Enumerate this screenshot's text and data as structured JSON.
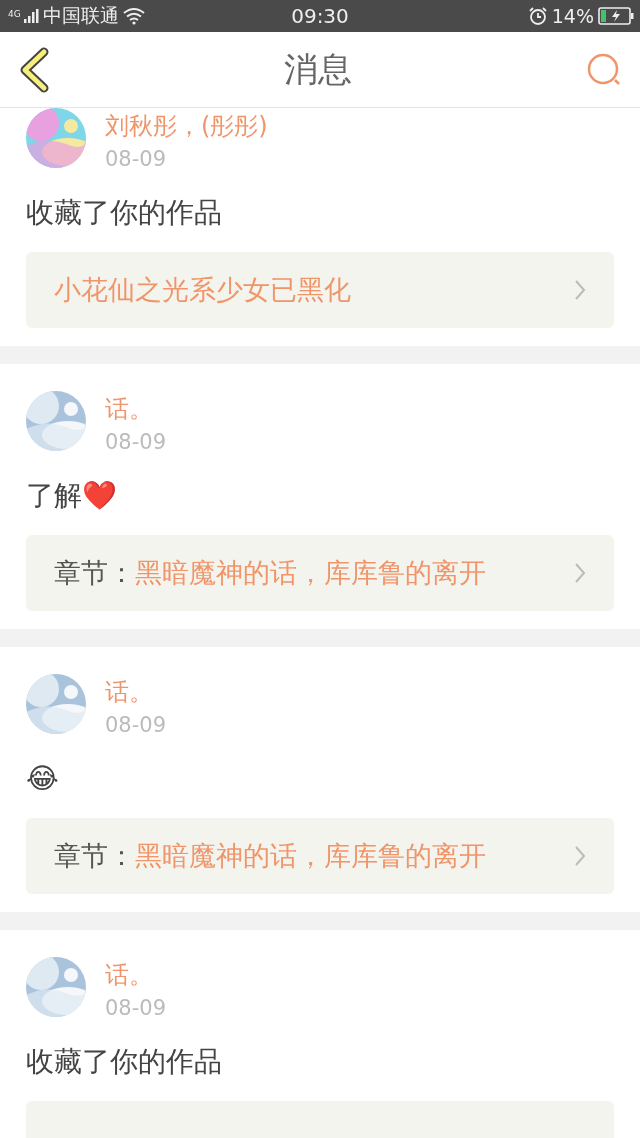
{
  "status_bar": {
    "network": "4G",
    "carrier": "中国联通",
    "time": "09:30",
    "battery": "14%"
  },
  "header": {
    "title": "消息"
  },
  "messages": [
    {
      "name": "刘秋彤，(彤彤)",
      "date": "08-09",
      "body": "收藏了你的作品",
      "link": {
        "kind": "work",
        "title": "小花仙之光系少女已黑化"
      }
    },
    {
      "name": "话。",
      "date": "08-09",
      "body": "了解❤️",
      "link": {
        "kind": "chapter",
        "label": "章节：",
        "title": "黑暗魔神的话，库库鲁的离开"
      }
    },
    {
      "name": "话。",
      "date": "08-09",
      "body": "😂",
      "link": {
        "kind": "chapter",
        "label": "章节：",
        "title": "黑暗魔神的话，库库鲁的离开"
      }
    },
    {
      "name": "话。",
      "date": "08-09",
      "body": "收藏了你的作品",
      "link": {
        "kind": "cut"
      }
    }
  ]
}
